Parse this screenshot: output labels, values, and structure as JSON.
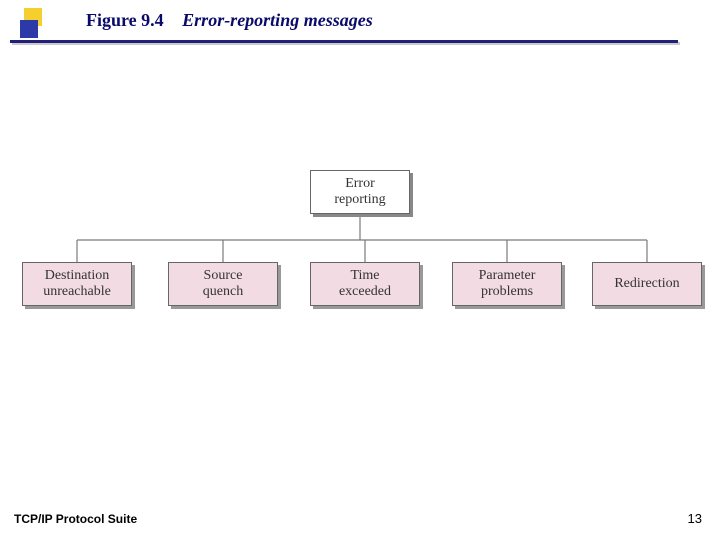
{
  "header": {
    "figure_label": "Figure 9.4",
    "caption": "Error-reporting messages"
  },
  "footer": {
    "book": "TCP/IP Protocol Suite",
    "page_number": "13"
  },
  "colors": {
    "accent": "#202078",
    "bullet_yellow": "#f4cf2e",
    "bullet_blue": "#2b3aa8",
    "child_fill": "#f3dbe3"
  },
  "diagram": {
    "root": {
      "label": "Error\nreporting"
    },
    "children": [
      {
        "label": "Destination\nunreachable"
      },
      {
        "label": "Source\nquench"
      },
      {
        "label": "Time\nexceeded"
      },
      {
        "label": "Parameter\nproblems"
      },
      {
        "label": "Redirection"
      }
    ]
  }
}
